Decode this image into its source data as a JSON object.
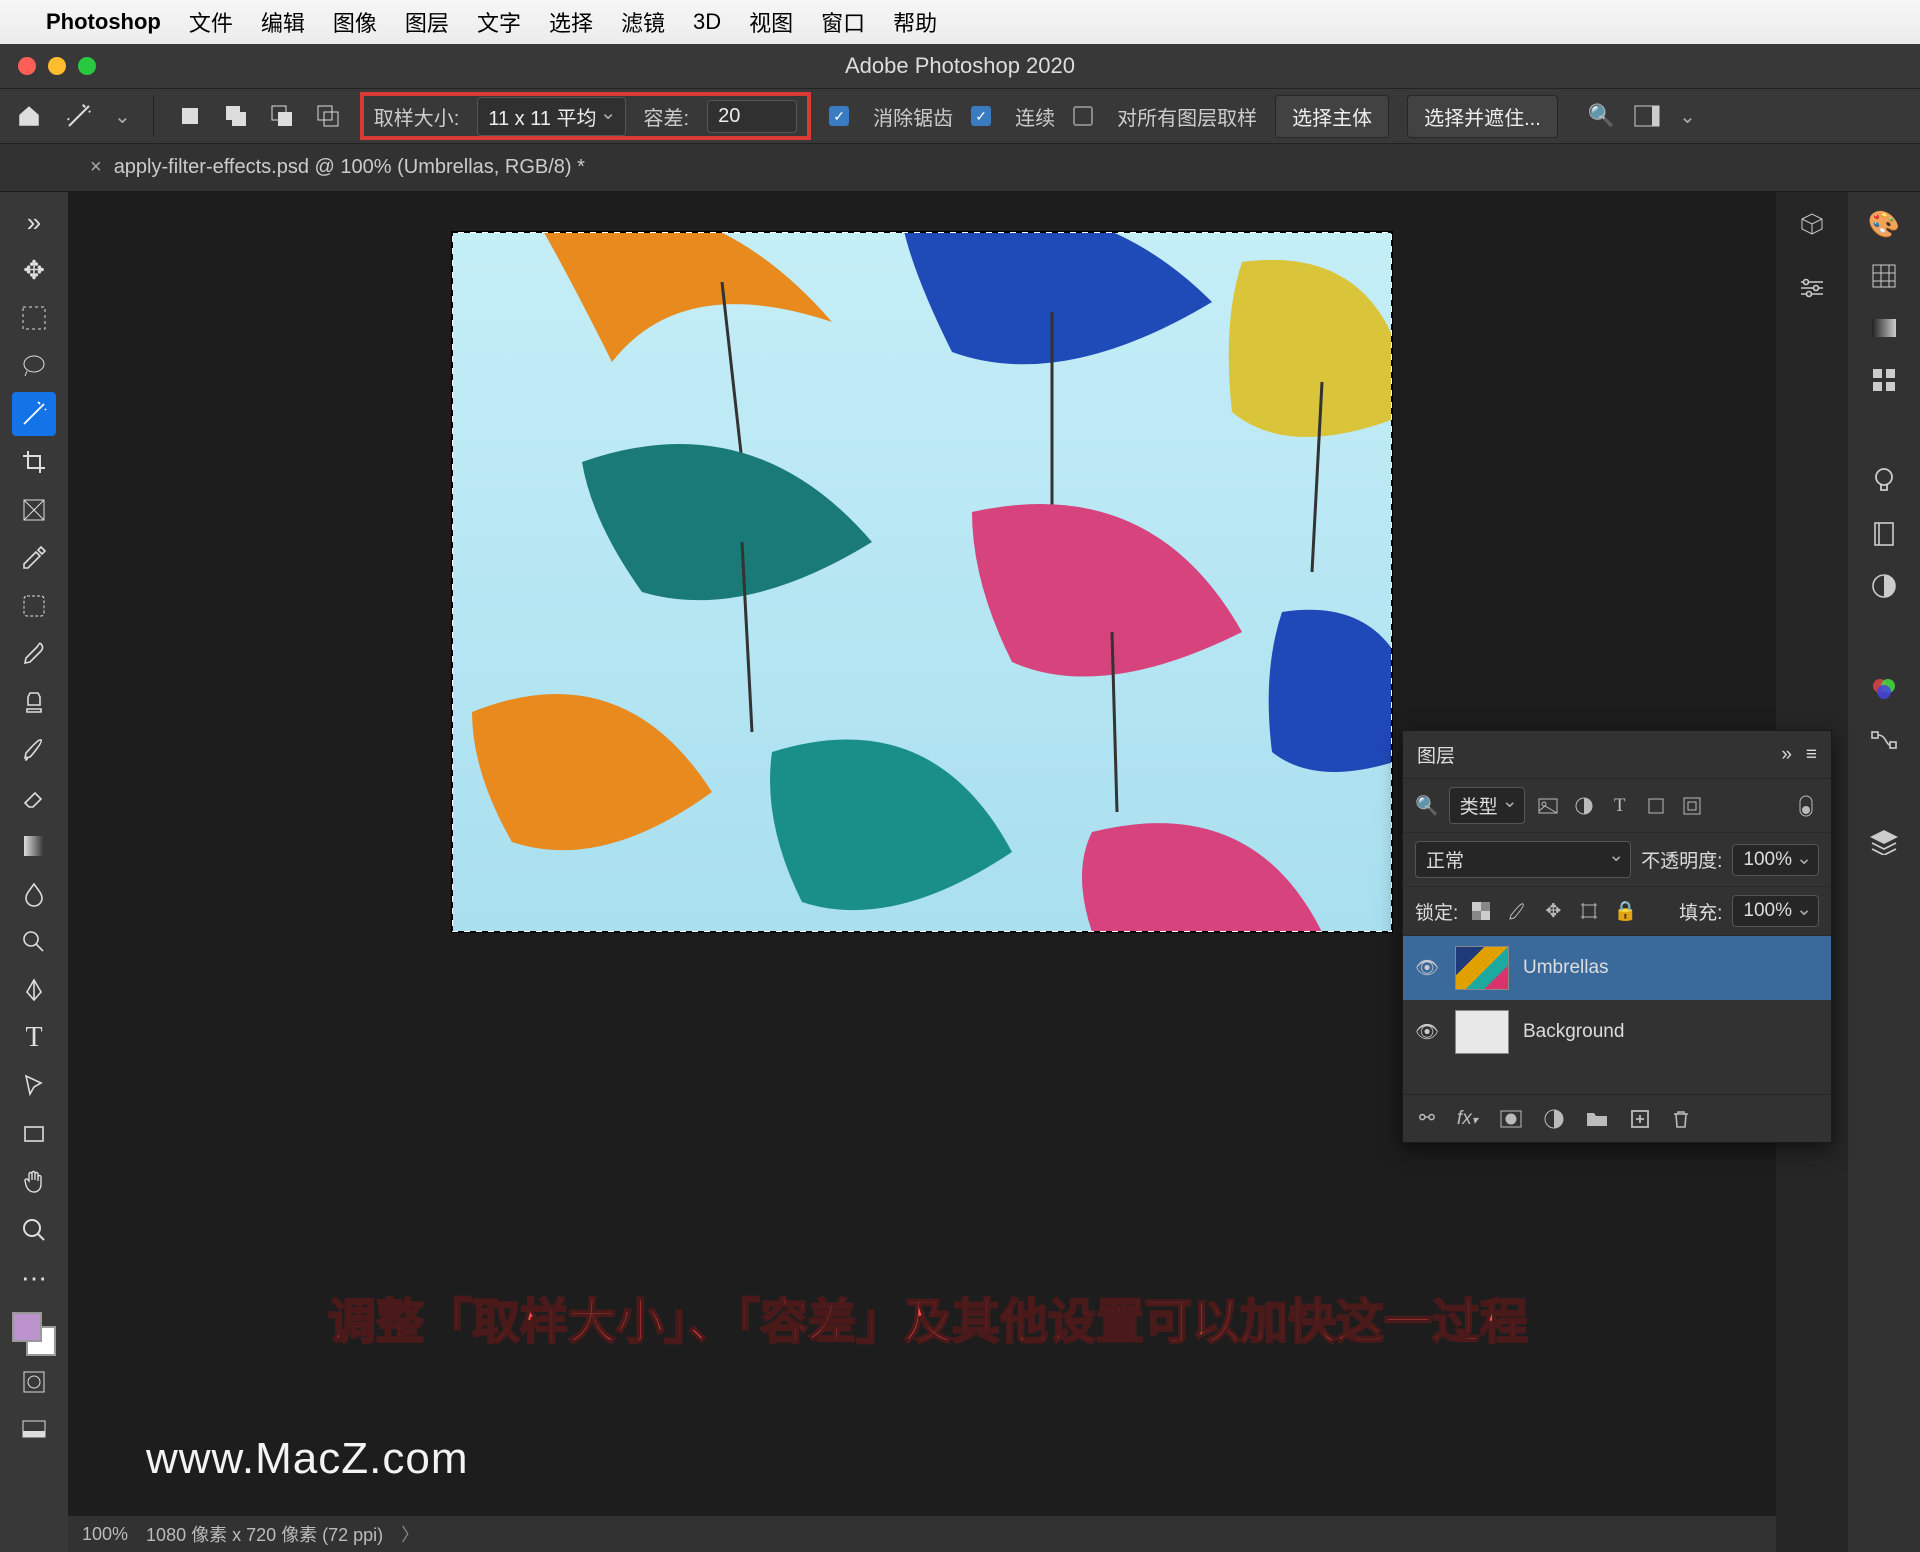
{
  "menubar": {
    "app": "Photoshop",
    "items": [
      "文件",
      "编辑",
      "图像",
      "图层",
      "文字",
      "选择",
      "滤镜",
      "3D",
      "视图",
      "窗口",
      "帮助"
    ]
  },
  "window": {
    "title": "Adobe Photoshop 2020"
  },
  "options": {
    "sample_label": "取样大小:",
    "sample_value": "11 x 11 平均",
    "tolerance_label": "容差:",
    "tolerance_value": "20",
    "antialias": "消除锯齿",
    "contiguous": "连续",
    "sample_all": "对所有图层取样",
    "select_subject": "选择主体",
    "select_and_mask": "选择并遮住..."
  },
  "tab": {
    "title": "apply-filter-effects.psd @ 100% (Umbrellas, RGB/8) *"
  },
  "layers": {
    "title": "图层",
    "filter": "类型",
    "blend": "正常",
    "opacity_label": "不透明度:",
    "opacity_value": "100%",
    "lock_label": "锁定:",
    "fill_label": "填充:",
    "fill_value": "100%",
    "items": [
      {
        "name": "Umbrellas",
        "selected": true
      },
      {
        "name": "Background",
        "selected": false
      }
    ]
  },
  "overlay_text": "调整「取样大小」、「容差」及其他设置可以加快这一过程",
  "watermark": "www.MacZ.com",
  "status": {
    "zoom": "100%",
    "dims": "1080 像素 x 720 像素 (72 ppi)"
  }
}
